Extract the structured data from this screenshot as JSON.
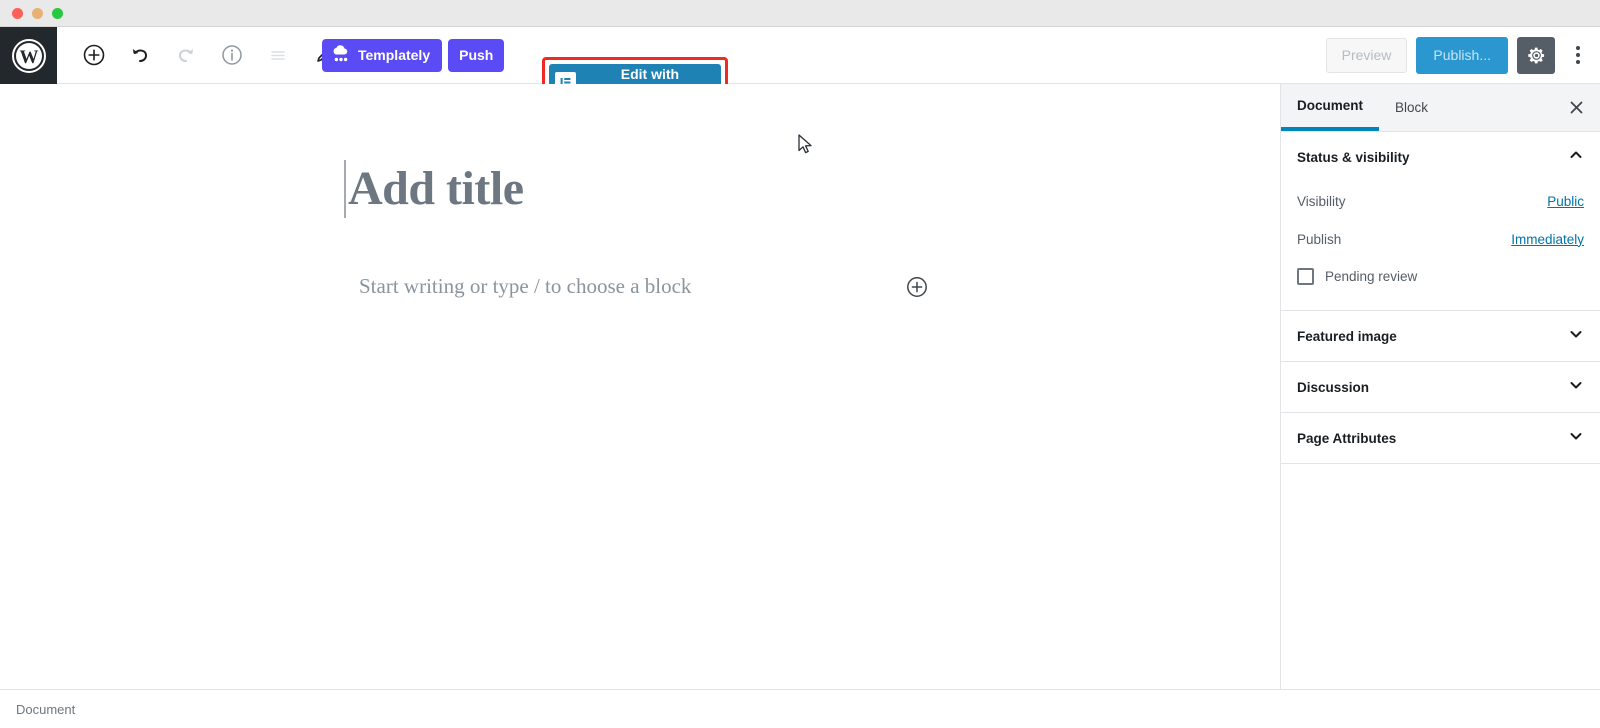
{
  "window": {
    "controls": [
      "close",
      "minimize",
      "maximize"
    ]
  },
  "toolbar": {
    "logo_icon": "wordpress-logo-icon",
    "icons": [
      {
        "name": "add-block-icon",
        "label": "Add block",
        "state": "enabled"
      },
      {
        "name": "undo-icon",
        "label": "Undo",
        "state": "enabled"
      },
      {
        "name": "redo-icon",
        "label": "Redo",
        "state": "disabled"
      },
      {
        "name": "content-info-icon",
        "label": "Content structure",
        "state": "enabled"
      },
      {
        "name": "list-view-icon",
        "label": "Block navigation",
        "state": "disabled"
      },
      {
        "name": "edit-pencil-icon",
        "label": "Edit",
        "state": "enabled"
      }
    ],
    "templately_label": "Templately",
    "templately_icon": "templately-cloud-icon",
    "push_label": "Push",
    "elementor_label": "Edit with Elementor",
    "elementor_icon": "elementor-document-icon",
    "preview_label": "Preview",
    "publish_label": "Publish...",
    "settings_icon": "gear-icon",
    "more_icon": "kebab-menu-icon"
  },
  "editor": {
    "title_placeholder": "Add title",
    "block_placeholder": "Start writing or type / to choose a block",
    "block_adder_icon": "plus-circle-icon"
  },
  "sidebar": {
    "tabs": [
      {
        "label": "Document",
        "active": true
      },
      {
        "label": "Block",
        "active": false
      }
    ],
    "close_icon": "close-icon",
    "panels": [
      {
        "title": "Status & visibility",
        "chevron": "chevron-up-icon",
        "expanded": true,
        "rows": [
          {
            "label": "Visibility",
            "value": "Public"
          },
          {
            "label": "Publish",
            "value": "Immediately"
          }
        ],
        "checkbox": {
          "label": "Pending review",
          "checked": false
        }
      },
      {
        "title": "Featured image",
        "chevron": "chevron-down-icon",
        "expanded": false
      },
      {
        "title": "Discussion",
        "chevron": "chevron-down-icon",
        "expanded": false
      },
      {
        "title": "Page Attributes",
        "chevron": "chevron-down-icon",
        "expanded": false
      }
    ]
  },
  "statusbar": {
    "text": "Document"
  },
  "highlight": {
    "target": "Edit with Elementor",
    "color": "#ee2a23"
  },
  "colors": {
    "templately_purple": "#5b4bf5",
    "elementor_blue": "#1e82b4",
    "publish_blue": "#2b97d0",
    "tab_accent": "#0085ba",
    "link_blue": "#0073aa",
    "wp_dark": "#23282d"
  }
}
